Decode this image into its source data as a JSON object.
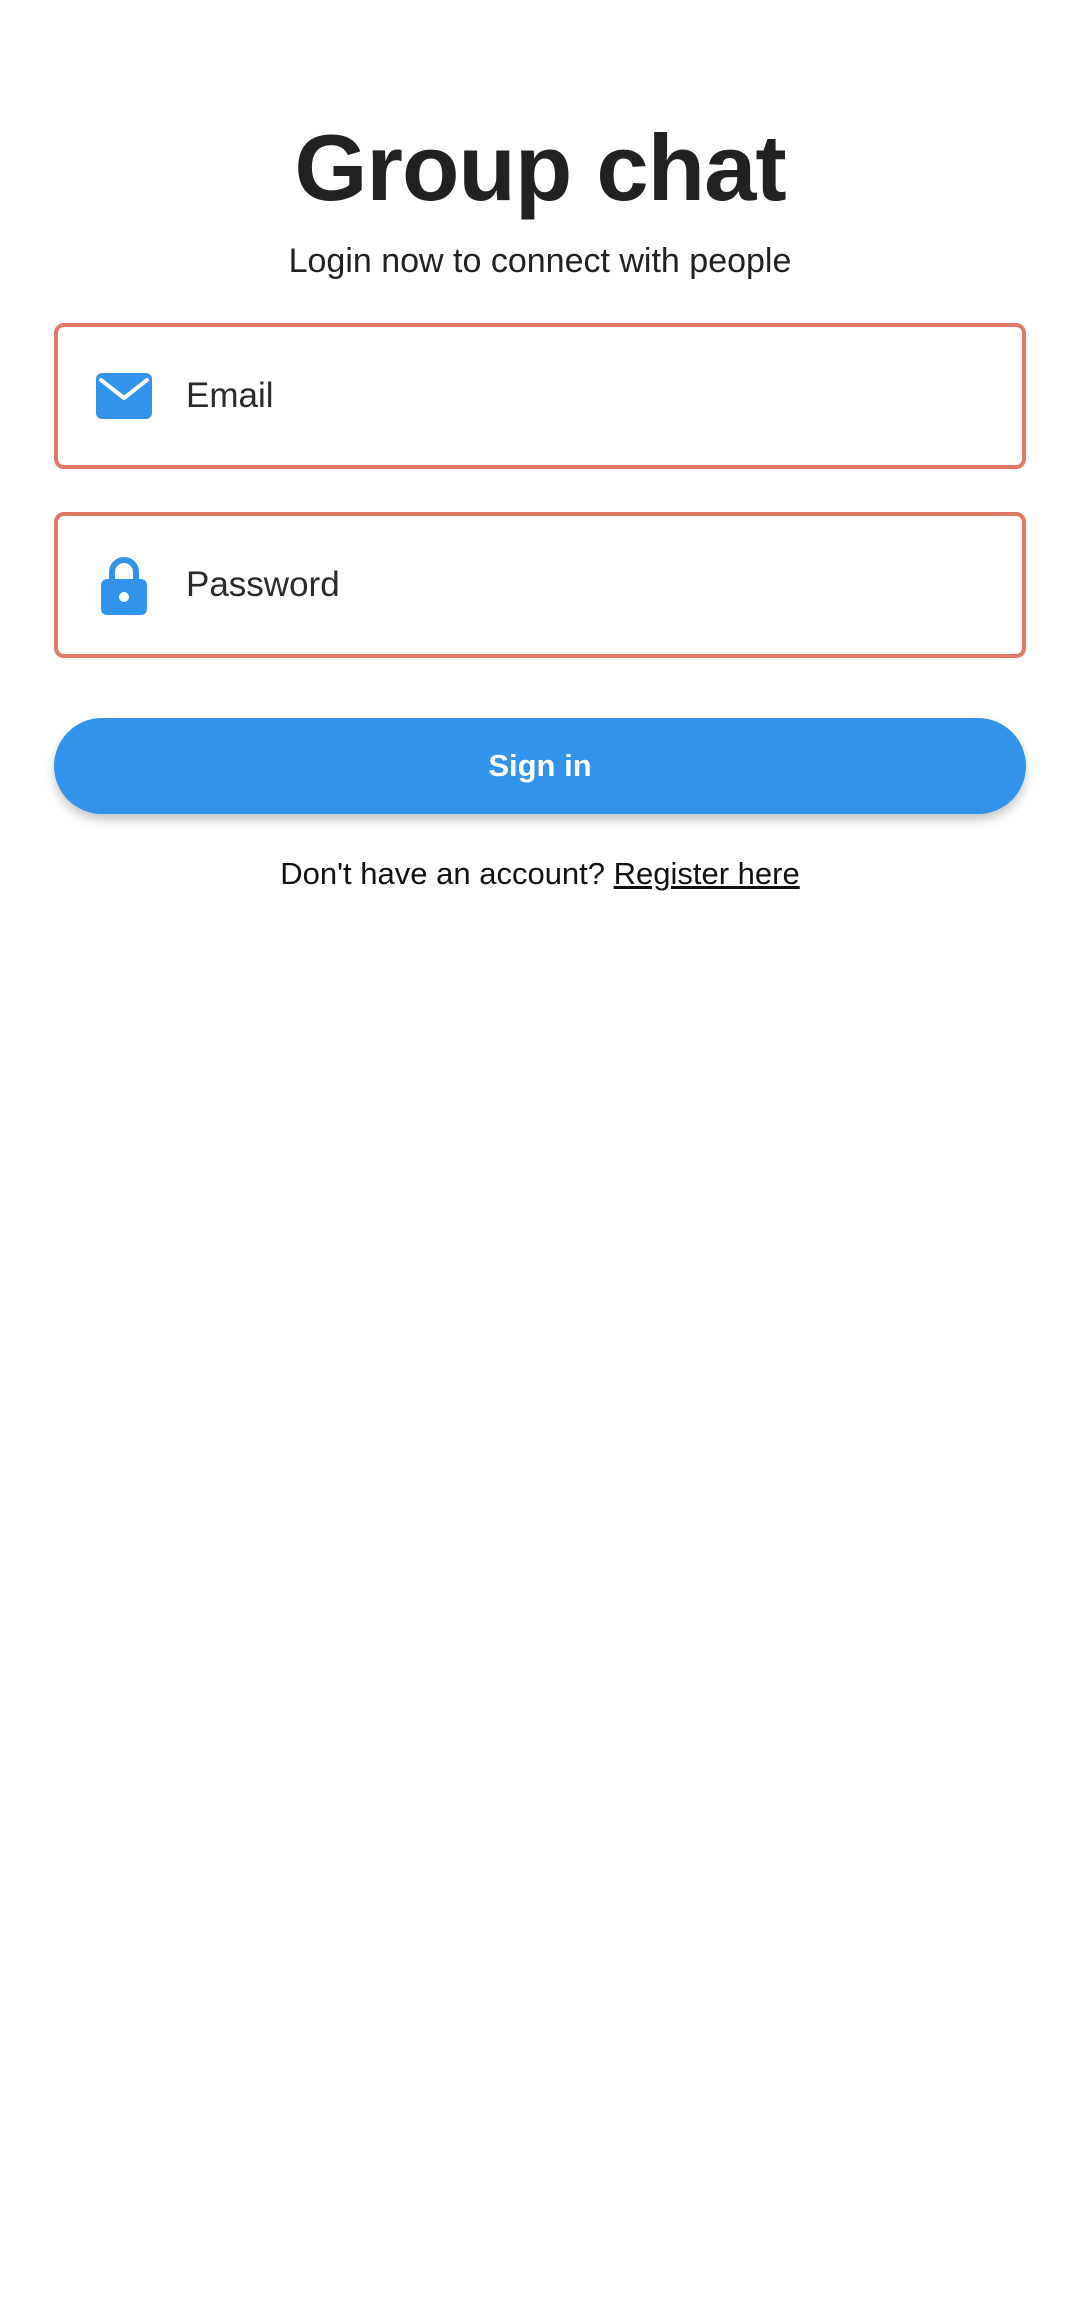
{
  "app": {
    "title": "Group chat",
    "subtitle": "Login now to connect with people"
  },
  "form": {
    "email": {
      "placeholder": "Email",
      "value": "",
      "icon": "envelope-icon"
    },
    "password": {
      "placeholder": "Password",
      "value": "",
      "icon": "lock-icon"
    },
    "signin_label": "Sign in",
    "register_prompt": "Don't have an account? ",
    "register_link": "Register here"
  },
  "colors": {
    "accent": "#3194ea",
    "field_border": "#e07865",
    "text": "#212121"
  }
}
